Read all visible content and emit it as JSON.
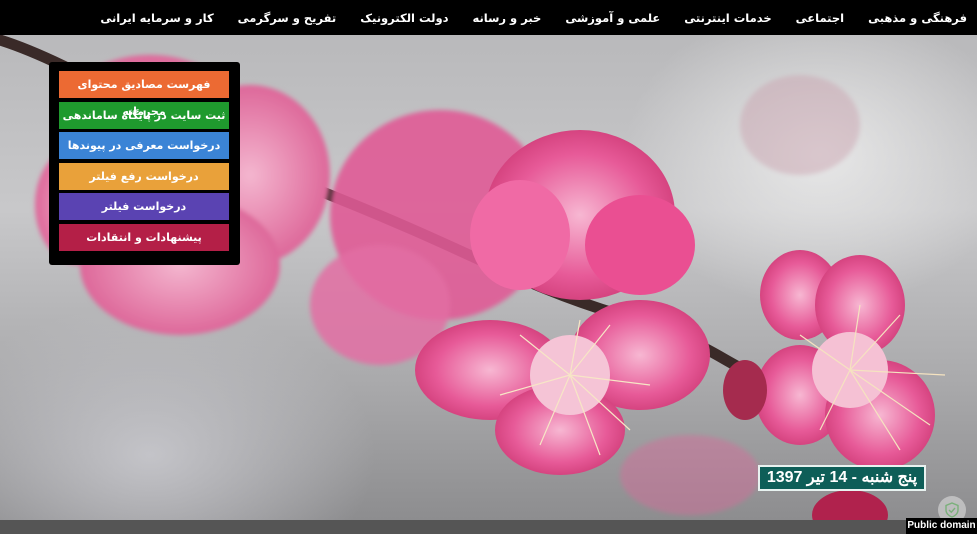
{
  "nav": {
    "items": [
      {
        "label": "فرهنگی و مذهبی"
      },
      {
        "label": "اجتماعی"
      },
      {
        "label": "خدمات اینترنتی"
      },
      {
        "label": "علمی و آموزشی"
      },
      {
        "label": "خبر و رسانه"
      },
      {
        "label": "دولت الکترونیک"
      },
      {
        "label": "تفریح و سرگرمی"
      },
      {
        "label": "کار و سرمایه ایرانی"
      }
    ]
  },
  "menu": {
    "items": [
      {
        "label": "فهرست مصادیق محتوای مجرمانه",
        "color": "#ec6a33"
      },
      {
        "label": "ثبت سایت در پایگاه ساماندهی",
        "color": "#1f9a2e"
      },
      {
        "label": "درخواست معرفی در پیوندها",
        "color": "#3b84d6"
      },
      {
        "label": "درخواست رفع فیلتر",
        "color": "#e9a13a"
      },
      {
        "label": "درخواست فیلتر",
        "color": "#5a43b2"
      },
      {
        "label": "پیشنهادات و انتقادات",
        "color": "#b41f47"
      }
    ]
  },
  "date": {
    "text": "پنج شنبه - 14 تیر 1397"
  },
  "credit": {
    "text": "Public domain"
  },
  "icons": {
    "scroll_top": "shield-check-icon"
  }
}
